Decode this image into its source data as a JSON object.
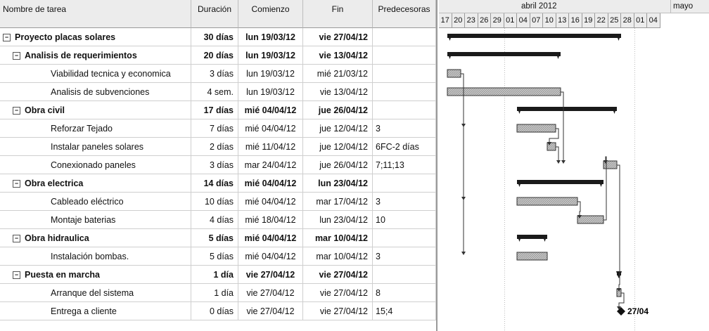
{
  "columns": {
    "name": "Nombre de tarea",
    "duration": "Duración",
    "start": "Comienzo",
    "end": "Fin",
    "pred": "Predecesoras"
  },
  "timeline": {
    "month1": "abril 2012",
    "month2": "mayo",
    "days": [
      "17",
      "20",
      "23",
      "26",
      "29",
      "01",
      "04",
      "07",
      "10",
      "13",
      "16",
      "19",
      "22",
      "25",
      "28",
      "01",
      "04"
    ]
  },
  "rows": [
    {
      "name": "Proyecto placas solares",
      "duration": "30 días",
      "start": "lun 19/03/12",
      "end": "vie 27/04/12",
      "pred": "",
      "level": 0,
      "bold": true,
      "summary": true
    },
    {
      "name": "Analisis de requerimientos",
      "duration": "20 días",
      "start": "lun 19/03/12",
      "end": "vie 13/04/12",
      "pred": "",
      "level": 1,
      "bold": true,
      "summary": true
    },
    {
      "name": "Viabilidad tecnica y economica",
      "duration": "3 días",
      "start": "lun 19/03/12",
      "end": "mié 21/03/12",
      "pred": "",
      "level": 2,
      "bold": false,
      "summary": false
    },
    {
      "name": "Analisis de subvenciones",
      "duration": "4 sem.",
      "start": "lun 19/03/12",
      "end": "vie 13/04/12",
      "pred": "",
      "level": 2,
      "bold": false,
      "summary": false
    },
    {
      "name": "Obra civil",
      "duration": "17 días",
      "start": "mié 04/04/12",
      "end": "jue 26/04/12",
      "pred": "",
      "level": 1,
      "bold": true,
      "summary": true
    },
    {
      "name": "Reforzar Tejado",
      "duration": "7 días",
      "start": "mié 04/04/12",
      "end": "jue 12/04/12",
      "pred": "3",
      "level": 2,
      "bold": false,
      "summary": false
    },
    {
      "name": "Instalar paneles solares",
      "duration": "2 días",
      "start": "mié 11/04/12",
      "end": "jue 12/04/12",
      "pred": "6FC-2 días",
      "level": 2,
      "bold": false,
      "summary": false
    },
    {
      "name": "Conexionado paneles",
      "duration": "3 días",
      "start": "mar 24/04/12",
      "end": "jue 26/04/12",
      "pred": "7;11;13",
      "level": 2,
      "bold": false,
      "summary": false
    },
    {
      "name": "Obra electrica",
      "duration": "14 días",
      "start": "mié 04/04/12",
      "end": "lun 23/04/12",
      "pred": "",
      "level": 1,
      "bold": true,
      "summary": true
    },
    {
      "name": "Cableado eléctrico",
      "duration": "10 días",
      "start": "mié 04/04/12",
      "end": "mar 17/04/12",
      "pred": "3",
      "level": 2,
      "bold": false,
      "summary": false
    },
    {
      "name": "Montaje baterias",
      "duration": "4 días",
      "start": "mié 18/04/12",
      "end": "lun 23/04/12",
      "pred": "10",
      "level": 2,
      "bold": false,
      "summary": false
    },
    {
      "name": "Obra hidraulica",
      "duration": "5 días",
      "start": "mié 04/04/12",
      "end": "mar 10/04/12",
      "pred": "",
      "level": 1,
      "bold": true,
      "summary": true
    },
    {
      "name": "Instalación bombas.",
      "duration": "5 días",
      "start": "mié 04/04/12",
      "end": "mar 10/04/12",
      "pred": "3",
      "level": 2,
      "bold": false,
      "summary": false
    },
    {
      "name": "Puesta en marcha",
      "duration": "1 día",
      "start": "vie 27/04/12",
      "end": "vie 27/04/12",
      "pred": "",
      "level": 1,
      "bold": true,
      "summary": true
    },
    {
      "name": "Arranque del sistema",
      "duration": "1 día",
      "start": "vie 27/04/12",
      "end": "vie 27/04/12",
      "pred": "8",
      "level": 2,
      "bold": false,
      "summary": false
    },
    {
      "name": "Entrega a cliente",
      "duration": "0 días",
      "start": "vie 27/04/12",
      "end": "vie 27/04/12",
      "pred": "15;4",
      "level": 2,
      "bold": false,
      "summary": false
    }
  ],
  "milestone_label": "27/04",
  "colors": {
    "summary_bar": "#1a1a1a",
    "task_bar": "#a8a8a8",
    "grid": "#cfcfcf",
    "header_bg": "#ececec"
  }
}
